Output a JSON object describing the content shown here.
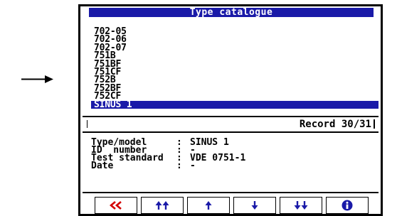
{
  "window": {
    "title": "Type catalogue"
  },
  "types": {
    "items": [
      "702-05",
      "702-06",
      "702-07",
      "751B",
      "751BF",
      "751CF",
      "752B",
      "752BF",
      "752CF",
      "SINUS 1"
    ],
    "selected_index": 9
  },
  "record": {
    "label": "Record 30/31"
  },
  "details": {
    "rows": [
      {
        "label": "Type/model",
        "value": "SINUS 1"
      },
      {
        "label": "ID  number",
        "value": "-"
      },
      {
        "label": "Test standard",
        "value": "VDE 0751-1"
      },
      {
        "label": "Date",
        "value": "-"
      }
    ]
  },
  "colors": {
    "highlight": "#1a1aa8",
    "first_button_icon": "#d40000",
    "icon": "#1a1aa8"
  },
  "toolbar": {
    "buttons": [
      {
        "icon": "double-chevron-left-icon"
      },
      {
        "icon": "double-arrow-up-icon"
      },
      {
        "icon": "arrow-up-icon"
      },
      {
        "icon": "arrow-down-icon"
      },
      {
        "icon": "double-arrow-down-icon"
      },
      {
        "icon": "info-icon"
      }
    ]
  }
}
